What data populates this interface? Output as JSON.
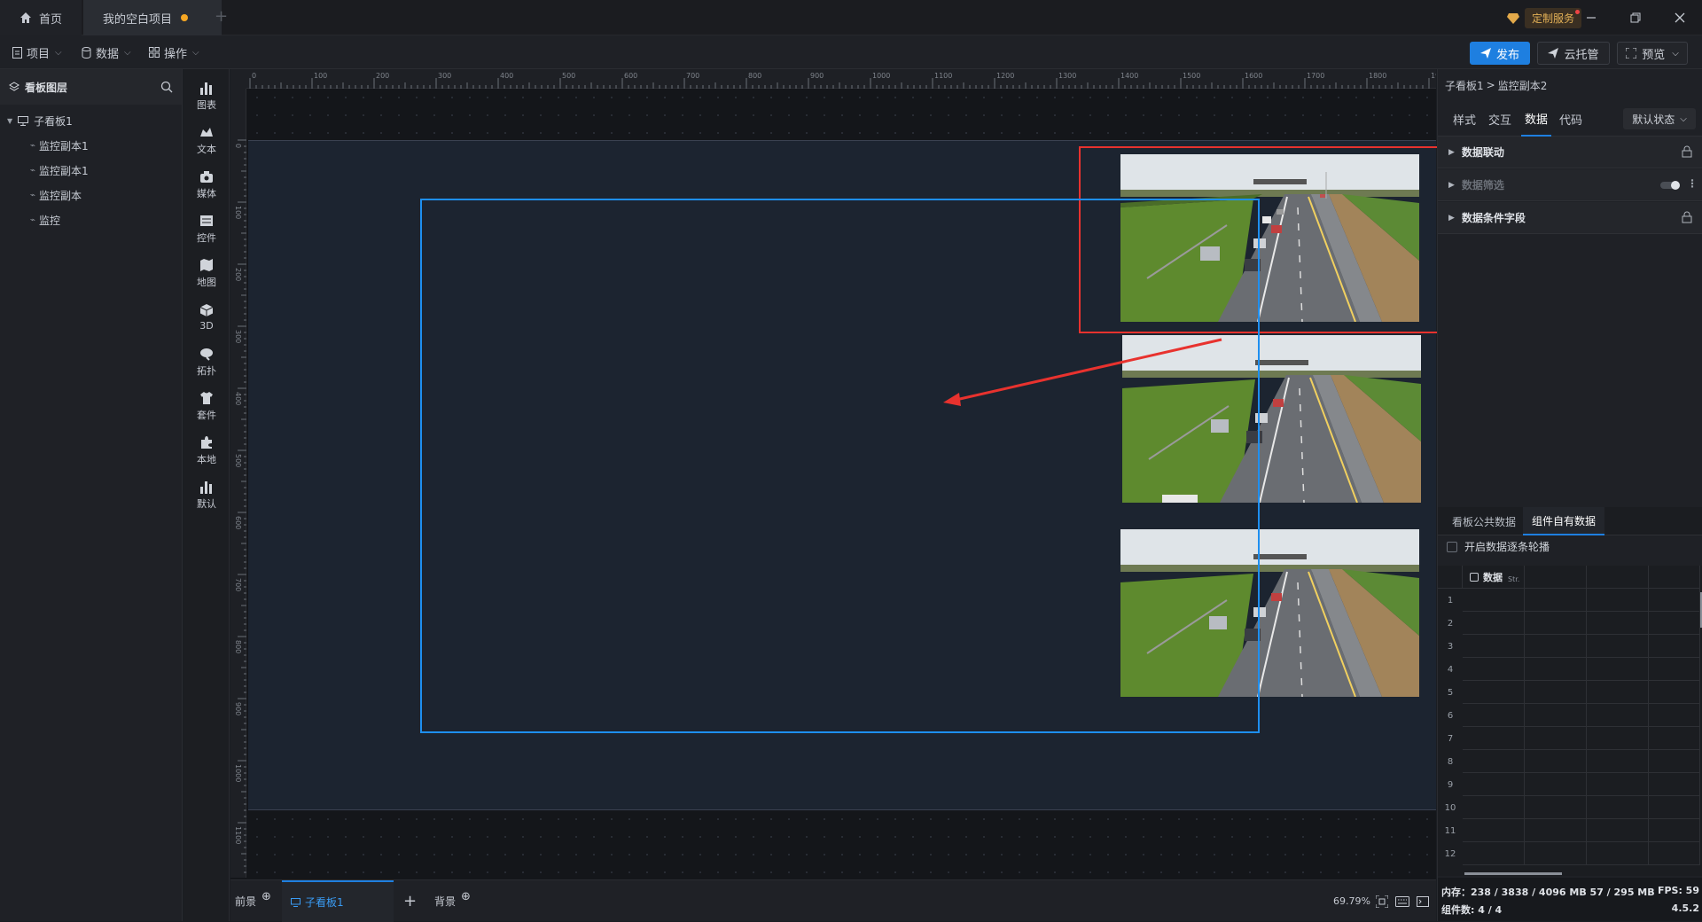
{
  "tabs": {
    "home": "首页",
    "project": "我的空白项目",
    "custom_service": "定制服务"
  },
  "menus": {
    "project": "项目",
    "data": "数据",
    "operation": "操作"
  },
  "toolbar": {
    "publish": "发布",
    "cloud": "云托管",
    "preview": "预览"
  },
  "layers": {
    "title": "看板图层",
    "root": "子看板1",
    "items": [
      "监控副本1",
      "监控副本1",
      "监控副本",
      "监控"
    ]
  },
  "toolbox": [
    "图表",
    "文本",
    "媒体",
    "控件",
    "地图",
    "3D",
    "拓扑",
    "套件",
    "本地",
    "默认"
  ],
  "ruler": {
    "top": [
      "0",
      "100",
      "200",
      "300",
      "400",
      "500",
      "600",
      "700",
      "800",
      "900",
      "1000",
      "1100",
      "1200",
      "1300",
      "1400",
      "1500",
      "1600",
      "1700",
      "1800",
      "1900"
    ],
    "left": [
      "0",
      "100",
      "200",
      "300",
      "400",
      "500",
      "600",
      "700",
      "800",
      "900",
      "1000",
      "1100"
    ]
  },
  "bottom": {
    "front": "前景",
    "board": "子看板1",
    "background": "背景",
    "zoom": "69.79%"
  },
  "right": {
    "breadcrumb_parent": "子看板1",
    "breadcrumb_sep": ">",
    "breadcrumb_current": "监控副本2",
    "tabs": [
      "样式",
      "交互",
      "数据",
      "代码"
    ],
    "state": "默认状态",
    "sections": [
      "数据联动",
      "数据筛选",
      "数据条件字段"
    ],
    "data_tabs": [
      "看板公共数据",
      "组件自有数据"
    ],
    "carousel": "开启数据逐条轮播",
    "grid_header": "数据",
    "grid_type": "Str.",
    "rows": [
      "1",
      "2",
      "3",
      "4",
      "5",
      "6",
      "7",
      "8",
      "9",
      "10",
      "11",
      "12"
    ]
  },
  "status": {
    "memory": "内存：238 / 3838 / 4096 MB  57 / 295 MB",
    "fps": "FPS: 59",
    "components": "组件数: 4 / 4",
    "version": "4.5.2"
  }
}
